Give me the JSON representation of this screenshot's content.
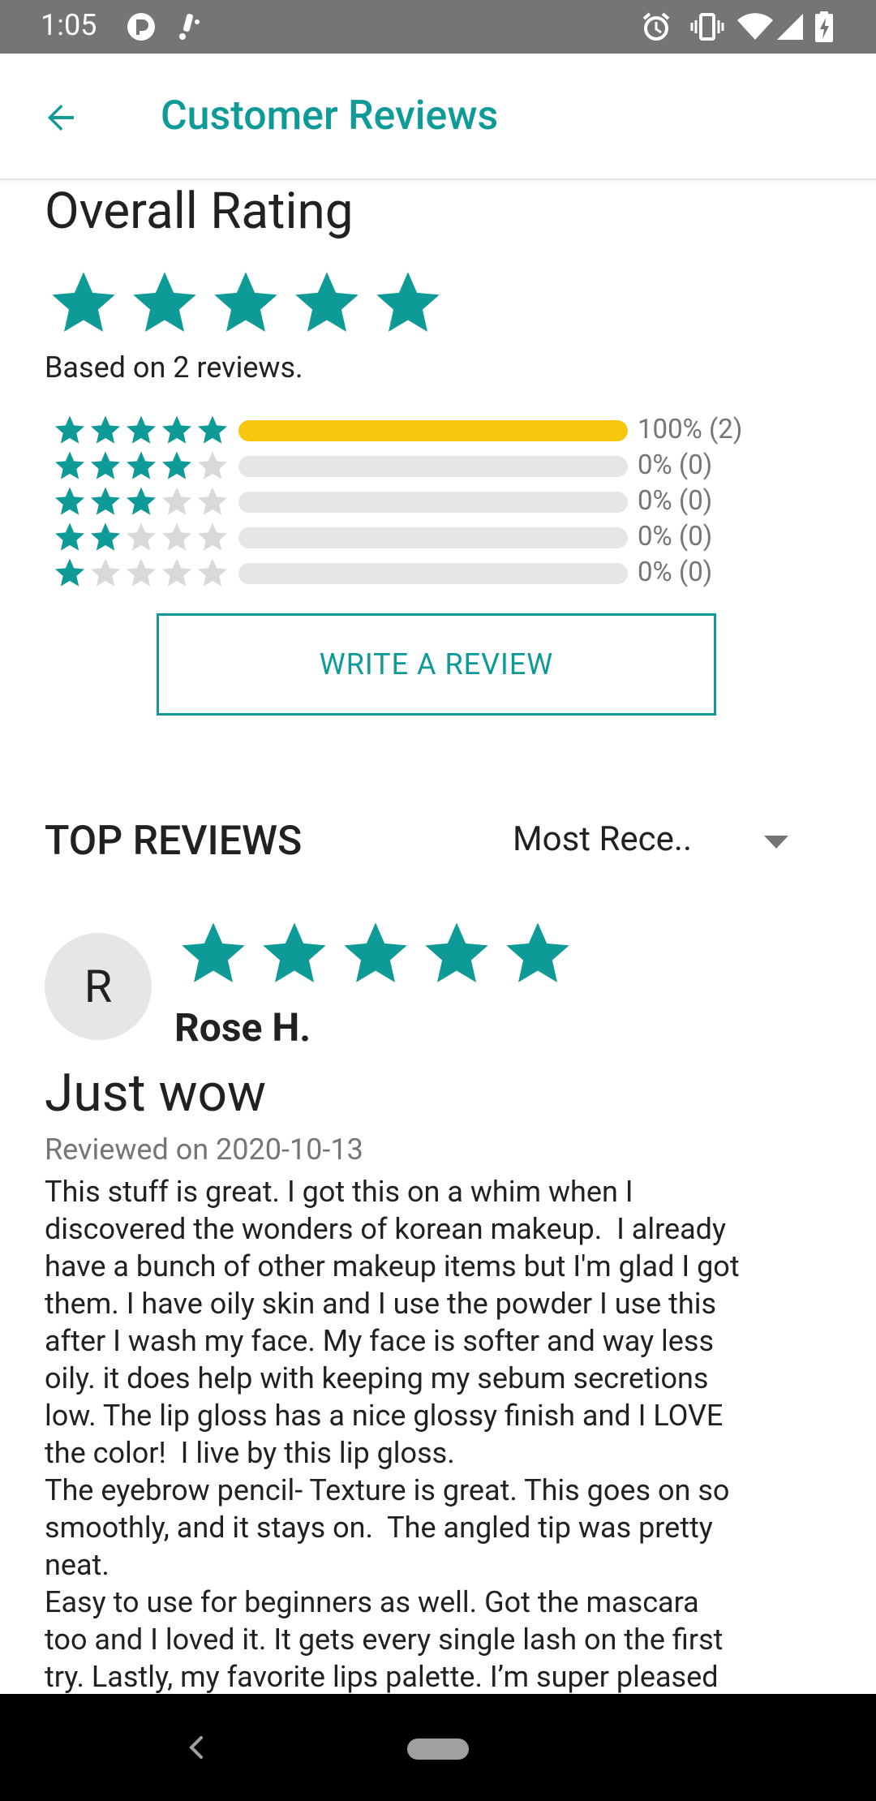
{
  "status_bar": {
    "time": "1:05",
    "icons": [
      "pocket-casts-icon",
      "notification-icon",
      "alarm-icon",
      "vibrate-icon",
      "wifi-icon",
      "signal-icon",
      "battery-charging-icon"
    ]
  },
  "app_bar": {
    "title": "Customer Reviews",
    "back_icon": "arrow-back-icon"
  },
  "overall": {
    "title": "Overall Rating",
    "stars": 5,
    "based_on": "Based on 2 reviews.",
    "distribution": [
      {
        "stars": 5,
        "fraction": 1.0,
        "label": "100% (2)"
      },
      {
        "stars": 4,
        "fraction": 0.0,
        "label": "0% (0)"
      },
      {
        "stars": 3,
        "fraction": 0.0,
        "label": "0% (0)"
      },
      {
        "stars": 2,
        "fraction": 0.0,
        "label": "0% (0)"
      },
      {
        "stars": 1,
        "fraction": 0.0,
        "label": "0% (0)"
      }
    ],
    "write_review_label": "WRITE A REVIEW"
  },
  "top_reviews": {
    "heading": "TOP REVIEWS",
    "sort_selected": "Most Rece.."
  },
  "review": {
    "avatar_initial": "R",
    "stars": 5,
    "reviewer": "Rose H.",
    "title": "Just wow",
    "date": "Reviewed on 2020-10-13",
    "body": "This stuff is great. I got this on a whim when I\ndiscovered the wonders of korean makeup.  I already\nhave a bunch of other makeup items but I'm glad I got\nthem. I have oily skin and I use the powder I use this\nafter I wash my face. My face is softer and way less\noily. it does help with keeping my sebum secretions\nlow. The lip gloss has a nice glossy finish and I LOVE\nthe color!  I live by this lip gloss.\nThe eyebrow pencil- Texture is great. This goes on so\nsmoothly, and it stays on.  The angled tip was pretty\nneat.\nEasy to use for beginners as well. Got the mascara\ntoo and I loved it. It gets every single lash on the first\ntry. Lastly, my favorite lips palette. I’m super pleased"
  },
  "colors": {
    "accent": "#0e9a97",
    "bar_fill": "#f6c70c",
    "bar_track": "#e6e6e6",
    "star_empty": "#d9d9d9",
    "status_bar": "#757575"
  },
  "nav_bar": {
    "back_icon": "nav-back-icon",
    "home_icon": "home-pill-icon"
  }
}
